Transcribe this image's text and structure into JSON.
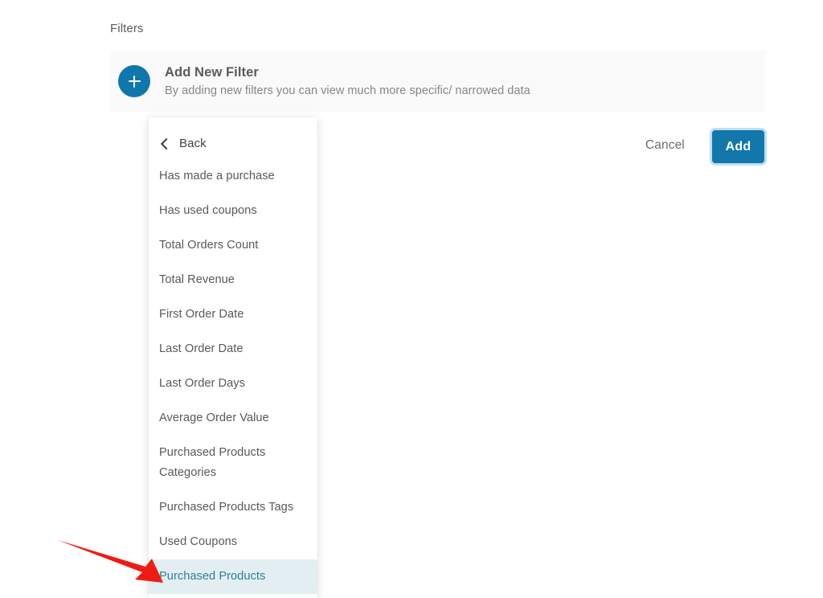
{
  "page": {
    "section_label": "Filters"
  },
  "banner": {
    "icon": "plus-icon",
    "title": "Add New Filter",
    "subtitle": "By adding new filters you can view much more specific/ narrowed data",
    "accent_color": "#1077ad",
    "background_color": "#fafafa"
  },
  "actions": {
    "cancel_label": "Cancel",
    "add_label": "Add",
    "add_button_color": "#1477ab",
    "add_button_focus_ring": "#86c8e8"
  },
  "dropdown": {
    "back_label": "Back",
    "back_icon": "chevron-left-icon",
    "selected_item": "Purchased Products",
    "selected_bg_color": "#e2eef2",
    "selected_text_color": "#2e8096",
    "items": [
      {
        "label": "Has made a purchase"
      },
      {
        "label": "Has used coupons"
      },
      {
        "label": "Total Orders Count"
      },
      {
        "label": "Total Revenue"
      },
      {
        "label": "First Order Date"
      },
      {
        "label": "Last Order Date"
      },
      {
        "label": "Last Order Days"
      },
      {
        "label": "Average Order Value"
      },
      {
        "label": "Purchased Products Categories"
      },
      {
        "label": "Purchased Products Tags"
      },
      {
        "label": "Used Coupons"
      },
      {
        "label": "Purchased Products"
      }
    ]
  },
  "annotation": {
    "arrow_color": "#ee1c15",
    "points_to": "Purchased Products"
  }
}
